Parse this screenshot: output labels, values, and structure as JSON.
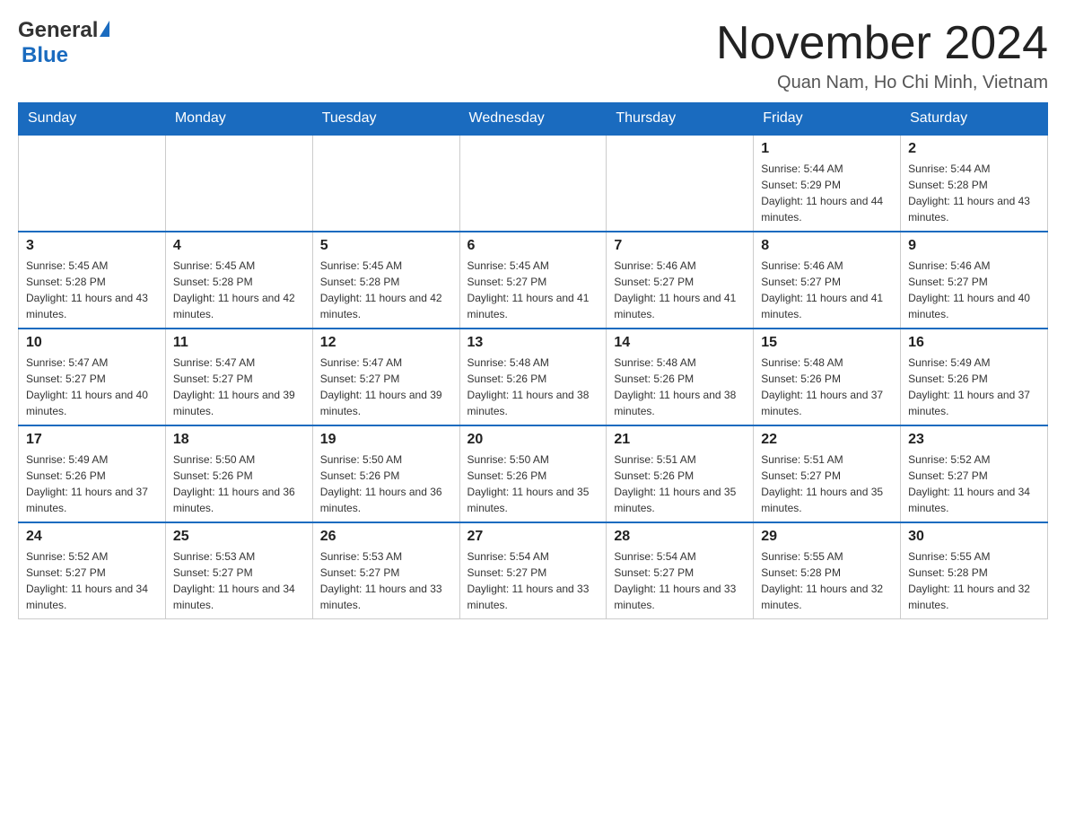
{
  "header": {
    "logo_general": "General",
    "logo_blue": "Blue",
    "month_title": "November 2024",
    "subtitle": "Quan Nam, Ho Chi Minh, Vietnam"
  },
  "days_of_week": [
    "Sunday",
    "Monday",
    "Tuesday",
    "Wednesday",
    "Thursday",
    "Friday",
    "Saturday"
  ],
  "weeks": [
    [
      {
        "day": "",
        "info": ""
      },
      {
        "day": "",
        "info": ""
      },
      {
        "day": "",
        "info": ""
      },
      {
        "day": "",
        "info": ""
      },
      {
        "day": "",
        "info": ""
      },
      {
        "day": "1",
        "info": "Sunrise: 5:44 AM\nSunset: 5:29 PM\nDaylight: 11 hours and 44 minutes."
      },
      {
        "day": "2",
        "info": "Sunrise: 5:44 AM\nSunset: 5:28 PM\nDaylight: 11 hours and 43 minutes."
      }
    ],
    [
      {
        "day": "3",
        "info": "Sunrise: 5:45 AM\nSunset: 5:28 PM\nDaylight: 11 hours and 43 minutes."
      },
      {
        "day": "4",
        "info": "Sunrise: 5:45 AM\nSunset: 5:28 PM\nDaylight: 11 hours and 42 minutes."
      },
      {
        "day": "5",
        "info": "Sunrise: 5:45 AM\nSunset: 5:28 PM\nDaylight: 11 hours and 42 minutes."
      },
      {
        "day": "6",
        "info": "Sunrise: 5:45 AM\nSunset: 5:27 PM\nDaylight: 11 hours and 41 minutes."
      },
      {
        "day": "7",
        "info": "Sunrise: 5:46 AM\nSunset: 5:27 PM\nDaylight: 11 hours and 41 minutes."
      },
      {
        "day": "8",
        "info": "Sunrise: 5:46 AM\nSunset: 5:27 PM\nDaylight: 11 hours and 41 minutes."
      },
      {
        "day": "9",
        "info": "Sunrise: 5:46 AM\nSunset: 5:27 PM\nDaylight: 11 hours and 40 minutes."
      }
    ],
    [
      {
        "day": "10",
        "info": "Sunrise: 5:47 AM\nSunset: 5:27 PM\nDaylight: 11 hours and 40 minutes."
      },
      {
        "day": "11",
        "info": "Sunrise: 5:47 AM\nSunset: 5:27 PM\nDaylight: 11 hours and 39 minutes."
      },
      {
        "day": "12",
        "info": "Sunrise: 5:47 AM\nSunset: 5:27 PM\nDaylight: 11 hours and 39 minutes."
      },
      {
        "day": "13",
        "info": "Sunrise: 5:48 AM\nSunset: 5:26 PM\nDaylight: 11 hours and 38 minutes."
      },
      {
        "day": "14",
        "info": "Sunrise: 5:48 AM\nSunset: 5:26 PM\nDaylight: 11 hours and 38 minutes."
      },
      {
        "day": "15",
        "info": "Sunrise: 5:48 AM\nSunset: 5:26 PM\nDaylight: 11 hours and 37 minutes."
      },
      {
        "day": "16",
        "info": "Sunrise: 5:49 AM\nSunset: 5:26 PM\nDaylight: 11 hours and 37 minutes."
      }
    ],
    [
      {
        "day": "17",
        "info": "Sunrise: 5:49 AM\nSunset: 5:26 PM\nDaylight: 11 hours and 37 minutes."
      },
      {
        "day": "18",
        "info": "Sunrise: 5:50 AM\nSunset: 5:26 PM\nDaylight: 11 hours and 36 minutes."
      },
      {
        "day": "19",
        "info": "Sunrise: 5:50 AM\nSunset: 5:26 PM\nDaylight: 11 hours and 36 minutes."
      },
      {
        "day": "20",
        "info": "Sunrise: 5:50 AM\nSunset: 5:26 PM\nDaylight: 11 hours and 35 minutes."
      },
      {
        "day": "21",
        "info": "Sunrise: 5:51 AM\nSunset: 5:26 PM\nDaylight: 11 hours and 35 minutes."
      },
      {
        "day": "22",
        "info": "Sunrise: 5:51 AM\nSunset: 5:27 PM\nDaylight: 11 hours and 35 minutes."
      },
      {
        "day": "23",
        "info": "Sunrise: 5:52 AM\nSunset: 5:27 PM\nDaylight: 11 hours and 34 minutes."
      }
    ],
    [
      {
        "day": "24",
        "info": "Sunrise: 5:52 AM\nSunset: 5:27 PM\nDaylight: 11 hours and 34 minutes."
      },
      {
        "day": "25",
        "info": "Sunrise: 5:53 AM\nSunset: 5:27 PM\nDaylight: 11 hours and 34 minutes."
      },
      {
        "day": "26",
        "info": "Sunrise: 5:53 AM\nSunset: 5:27 PM\nDaylight: 11 hours and 33 minutes."
      },
      {
        "day": "27",
        "info": "Sunrise: 5:54 AM\nSunset: 5:27 PM\nDaylight: 11 hours and 33 minutes."
      },
      {
        "day": "28",
        "info": "Sunrise: 5:54 AM\nSunset: 5:27 PM\nDaylight: 11 hours and 33 minutes."
      },
      {
        "day": "29",
        "info": "Sunrise: 5:55 AM\nSunset: 5:28 PM\nDaylight: 11 hours and 32 minutes."
      },
      {
        "day": "30",
        "info": "Sunrise: 5:55 AM\nSunset: 5:28 PM\nDaylight: 11 hours and 32 minutes."
      }
    ]
  ]
}
